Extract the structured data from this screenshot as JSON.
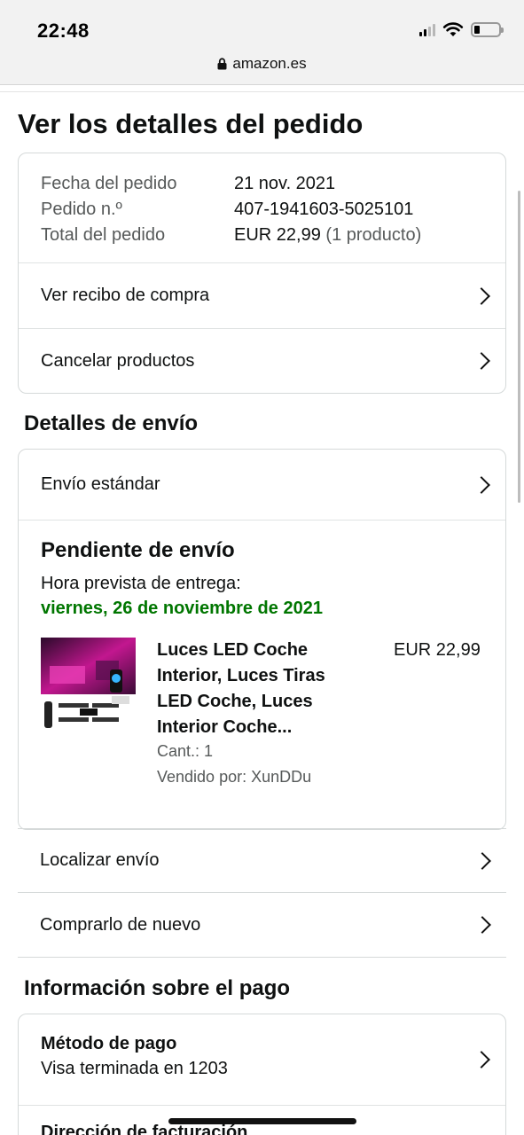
{
  "status_bar": {
    "time": "22:48",
    "url": "amazon.es"
  },
  "page": {
    "title": "Ver los detalles del pedido"
  },
  "order": {
    "date_label": "Fecha del pedido",
    "date_value": "21 nov. 2021",
    "number_label": "Pedido n.º",
    "number_value": "407-1941603-5025101",
    "total_label": "Total del pedido",
    "total_value": "EUR 22,99",
    "total_extra": "(1 producto)",
    "receipt_link": "Ver recibo de compra",
    "cancel_link": "Cancelar productos"
  },
  "shipping": {
    "section_title": "Detalles de envío",
    "method": "Envío estándar",
    "status": "Pendiente de envío",
    "eta_label": "Hora prevista de entrega:",
    "eta_date": "viernes, 26 de noviembre de 2021",
    "product": {
      "title": "Luces LED Coche Interior, Luces Tiras LED Coche, Luces Interior Coche...",
      "price": "EUR 22,99",
      "qty": "Cant.: 1",
      "seller": "Vendido por: XunDDu"
    },
    "track_link": "Localizar envío",
    "buy_again_link": "Comprarlo de nuevo"
  },
  "payment": {
    "section_title": "Información sobre el pago",
    "method_label": "Método de pago",
    "method_value": "Visa terminada en 1203",
    "billing_label": "Dirección de facturación"
  },
  "colors": {
    "accent_green": "#007600",
    "text": "#0f1111",
    "muted": "#565959",
    "border": "#d5d9d9"
  }
}
